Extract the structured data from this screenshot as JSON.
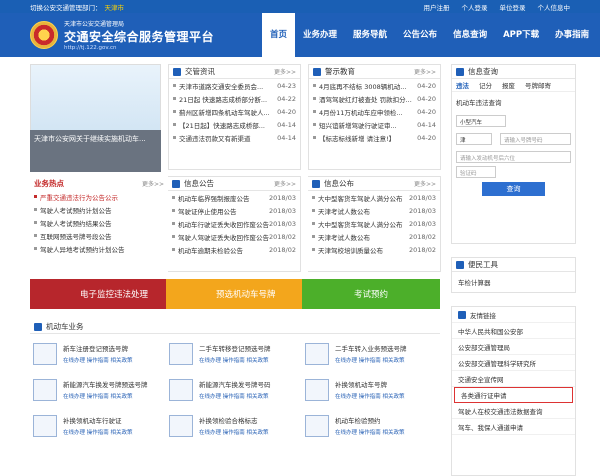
{
  "top": {
    "left": "切换公安交通管理部门：",
    "city": "天津市",
    "links": [
      "用户注册",
      "个人登录",
      "单位登录",
      "个人信息中",
      "个"
    ]
  },
  "header": {
    "small": "天津市公安交通管理局",
    "title": "交通安全综合服务管理平台",
    "url": "http://tj.122.gov.cn"
  },
  "nav": [
    "首页",
    "业务办理",
    "服务导航",
    "公告公布",
    "信息查询",
    "APP下载",
    "办事指南"
  ],
  "banner": {
    "caption": "天津市公安网关于继续实施机动车..."
  },
  "jiaoguan": {
    "title": "交管资讯",
    "more": "更多>>",
    "items": [
      [
        "天津市道路交通安全委员会...",
        "04-23"
      ],
      [
        "21日起 快速路志成桥部分断...",
        "04-22"
      ],
      [
        "蓟州区新增四条机动车驾驶人...",
        "04-20"
      ],
      [
        "【21日起】快速路志成桥部...",
        "04-14"
      ],
      [
        "交通违法罚款又有新渠道",
        "04-14"
      ]
    ]
  },
  "jingshi": {
    "title": "警示教育",
    "more": "更多>>",
    "items": [
      [
        "4月底再不结标 3008辆机动...",
        "04-20"
      ],
      [
        "酒驾驾驶红灯被查处 罚款扣分...",
        "04-20"
      ],
      [
        "4月份11万机动车应申领检...",
        "04-20"
      ],
      [
        "短兴谊新增驾驶行驶证审...",
        "04-14"
      ],
      [
        "【标志标线新增 请注意!】",
        "04-20"
      ]
    ]
  },
  "hot": {
    "title": "业务热点",
    "more": "更多>>",
    "items": [
      "严重交通违法行为公告公示",
      "驾驶人考试预约计划公告",
      "驾驶人考试预约结果公告",
      "互联网预选号牌号段公告",
      "驾驶人异地考试预约计划公告"
    ]
  },
  "notice1": {
    "title": "信息公告",
    "more": "更多>>",
    "items": [
      [
        "机动车临界强制报废公告",
        "2018/03"
      ],
      [
        "驾驶证停止使用公告",
        "2018/03"
      ],
      [
        "机动车行驶证丢失收回作废公告",
        "2018/03"
      ],
      [
        "驾驶人驾驶证丢失收回作废公告",
        "2018/02"
      ],
      [
        "机动车逾期未检验公告",
        "2018/02"
      ]
    ]
  },
  "notice2": {
    "title": "信息公布",
    "more": "更多>>",
    "items": [
      [
        "大中型客货车驾驶人满分公布",
        "2018/03"
      ],
      [
        "天津考试人数公布",
        "2018/03"
      ],
      [
        "大中型客货车驾驶人满分公布",
        "2018/03"
      ],
      [
        "天津考试人数公布",
        "2018/02"
      ],
      [
        "天津驾校培训质量公布",
        "2018/02"
      ]
    ]
  },
  "bars": [
    "电子监控违法处理",
    "预选机动车号牌",
    "考试预约"
  ],
  "service": {
    "title": "机动车业务",
    "items": [
      [
        "新车注册登记预选号牌",
        "在线办理 操作指南 相关政策"
      ],
      [
        "二手车转移登记预选号牌",
        "在线办理 操作指南 相关政策"
      ],
      [
        "二手车转入业务预选号牌",
        "在线办理 操作指南 相关政策"
      ],
      [
        "新能源汽车换发号牌预选号牌",
        "在线办理 操作指南 相关政策"
      ],
      [
        "新能源汽车换发号牌号码",
        "在线办理 操作指南 相关政策"
      ],
      [
        "补换领机动车号牌",
        "在线办理 操作指南 相关政策"
      ],
      [
        "补换领机动车行驶证",
        "在线办理 操作指南 相关政策"
      ],
      [
        "补换领检验合格标志",
        "在线办理 操作指南 相关政策"
      ],
      [
        "机动车检验预约",
        "在线办理 操作指南 相关政策"
      ]
    ]
  },
  "query": {
    "title": "信息查询",
    "tabs": [
      "违法",
      "记分",
      "报废",
      "号牌邮寄"
    ],
    "sub": "机动车违法查询",
    "type": "小型汽车",
    "plate_prefix": "津",
    "plate_ph": "请输入号牌号码",
    "engine_ph": "请输入发动机号后六位",
    "captcha_ph": "验证码",
    "btn": "查询"
  },
  "tools": {
    "title": "便民工具",
    "items": [
      "车检计算器"
    ]
  },
  "links": {
    "title": "友情链接",
    "items": [
      "中华人民共和国公安部",
      "公安部交通管理局",
      "公安部交通管理科学研究所",
      "交通安全宣传网",
      "各类通行证申请",
      "驾驶人在校交通违法数据查询",
      "驾车、我保人通道申请"
    ]
  }
}
